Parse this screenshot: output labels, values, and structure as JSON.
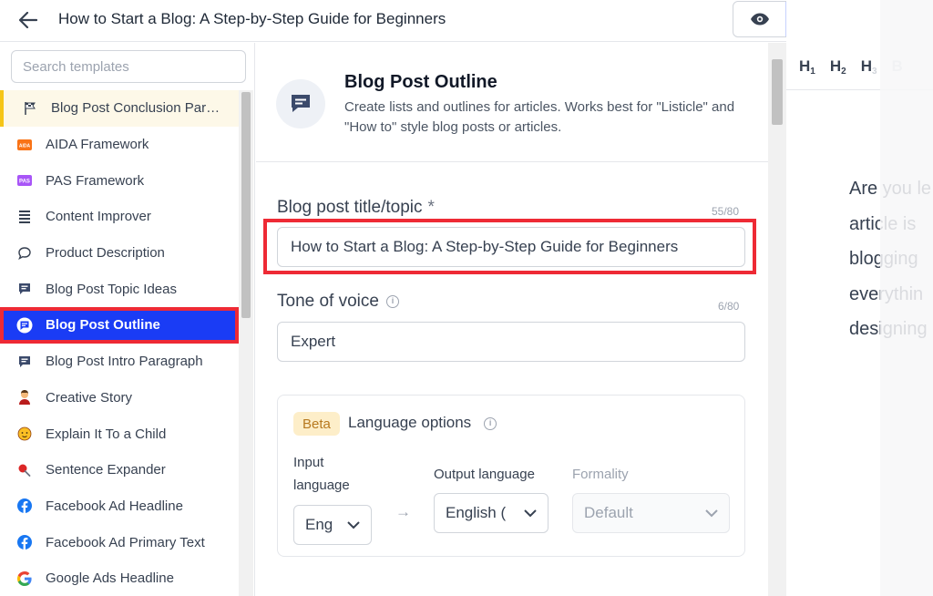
{
  "topbar": {
    "document_title": "How to Start a Blog: A Step-by-Step Guide for Beginners"
  },
  "sidebar": {
    "search_placeholder": "Search templates",
    "items": [
      {
        "label": "Blog Post Conclusion Par…",
        "icon": "flag-icon"
      },
      {
        "label": "AIDA Framework",
        "icon": "aida-icon"
      },
      {
        "label": "PAS Framework",
        "icon": "pas-icon"
      },
      {
        "label": "Content Improver",
        "icon": "lines-icon"
      },
      {
        "label": "Product Description",
        "icon": "speech-bubble-icon"
      },
      {
        "label": "Blog Post Topic Ideas",
        "icon": "chat-icon"
      },
      {
        "label": "Blog Post Outline",
        "icon": "chat-icon"
      },
      {
        "label": "Blog Post Intro Paragraph",
        "icon": "chat-icon"
      },
      {
        "label": "Creative Story",
        "icon": "storyteller-icon"
      },
      {
        "label": "Explain It To a Child",
        "icon": "child-face-icon"
      },
      {
        "label": "Sentence Expander",
        "icon": "pin-icon"
      },
      {
        "label": "Facebook Ad Headline",
        "icon": "facebook-icon"
      },
      {
        "label": "Facebook Ad Primary Text",
        "icon": "facebook-icon"
      },
      {
        "label": "Google Ads Headline",
        "icon": "google-icon"
      }
    ]
  },
  "template": {
    "title": "Blog Post Outline",
    "description": "Create lists and outlines for articles. Works best for \"Listicle\" and \"How to\" style blog posts or articles."
  },
  "form": {
    "topic_label": "Blog post title/topic",
    "topic_required": "*",
    "topic_counter": "55/80",
    "topic_value": "How to Start a Blog: A Step-by-Step Guide for Beginners",
    "tone_label": "Tone of voice",
    "tone_counter": "6/80",
    "tone_value": "Expert"
  },
  "language": {
    "beta_badge": "Beta",
    "title": "Language options",
    "input_label_line1": "Input",
    "input_label_line2": "language",
    "input_value": "Eng",
    "arrow": "→",
    "output_label": "Output language",
    "output_value": "English (",
    "formality_label": "Formality",
    "formality_value": "Default"
  },
  "editor": {
    "toolbar": {
      "h1": "H",
      "h1_sub": "1",
      "h2": "H",
      "h2_sub": "2",
      "h3": "H",
      "h3_sub": "3",
      "bold": "B"
    },
    "lines": [
      "Are you le",
      "article is",
      "blogging",
      "everythin",
      "designing"
    ]
  },
  "colors": {
    "selected_bg": "#1a3cf5",
    "highlight_border": "#ee2a35",
    "beta_bg": "#fdeec9"
  }
}
